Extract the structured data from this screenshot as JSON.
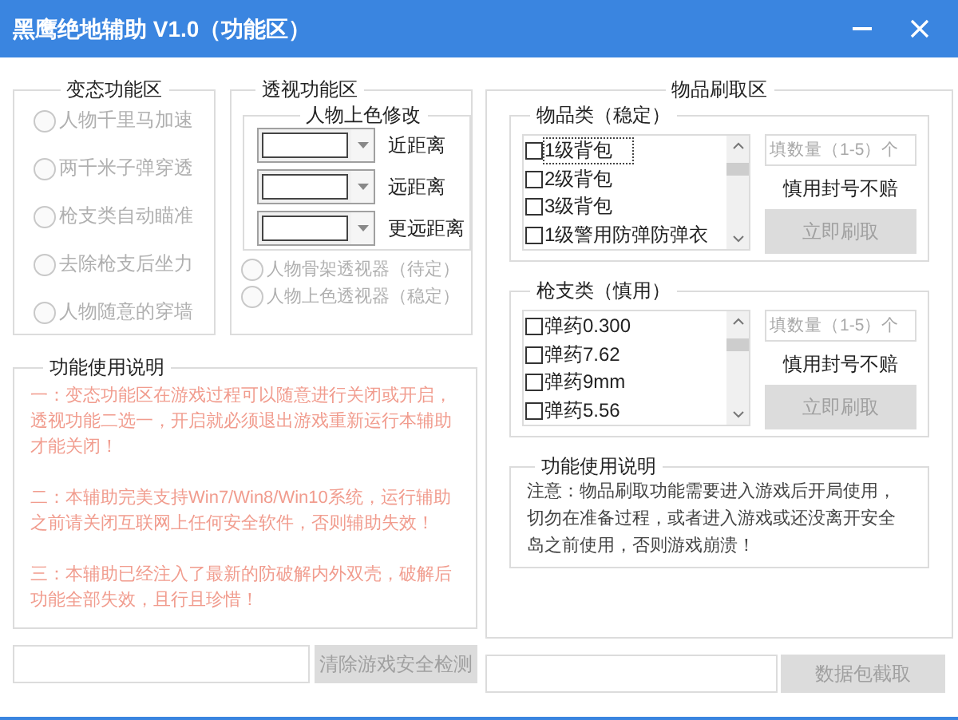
{
  "window": {
    "title": "黑鹰绝地辅助 V1.0（功能区）"
  },
  "mod_group": {
    "title": "变态功能区",
    "options": [
      {
        "label": "人物千里马加速",
        "checked": false,
        "disabled": true
      },
      {
        "label": "两千米子弹穿透",
        "checked": false,
        "disabled": true
      },
      {
        "label": "枪支类自动瞄准",
        "checked": false,
        "disabled": true
      },
      {
        "label": "去除枪支后坐力",
        "checked": false,
        "disabled": true
      },
      {
        "label": "人物随意的穿墙",
        "checked": false,
        "disabled": true
      }
    ]
  },
  "esp_group": {
    "title": "透视功能区",
    "color_group": {
      "title": "人物上色修改",
      "rows": [
        {
          "label": "近距离"
        },
        {
          "label": "远距离"
        },
        {
          "label": "更远距离"
        }
      ]
    },
    "options": [
      {
        "label": "人物骨架透视器（待定）",
        "checked": false,
        "disabled": true
      },
      {
        "label": "人物上色透视器（稳定）",
        "checked": false,
        "disabled": true
      }
    ]
  },
  "notes_left": {
    "title": "功能使用说明",
    "paragraphs": [
      "一：变态功能区在游戏过程可以随意进行关闭或开启，透视功能二选一，开启就必须退出游戏重新运行本辅助才能关闭！",
      "二：本辅助完美支持Win7/Win8/Win10系统，运行辅助之前请关闭互联网上任何安全软件，否则辅助失效！",
      "三：本辅助已经注入了最新的防破解内外双壳，破解后功能全部失效，且行且珍惜！"
    ]
  },
  "bottom_left": {
    "button": "清除游戏安全检测",
    "disabled": true
  },
  "items_area": {
    "title": "物品刷取区",
    "sections": [
      {
        "title": "物品类（稳定）",
        "items": [
          {
            "label": "1级背包",
            "checked": false,
            "focused": true
          },
          {
            "label": "2级背包",
            "checked": false,
            "focused": false
          },
          {
            "label": "3级背包",
            "checked": false,
            "focused": false
          },
          {
            "label": "1级警用防弹防弹衣",
            "checked": false,
            "focused": false
          }
        ],
        "quantity_placeholder": "填数量（1-5）个",
        "warning": "慎用封号不赔",
        "button": "立即刷取",
        "disabled": true
      },
      {
        "title": "枪支类（慎用）",
        "items": [
          {
            "label": "弹药0.300",
            "checked": false,
            "focused": false
          },
          {
            "label": "弹药7.62",
            "checked": false,
            "focused": false
          },
          {
            "label": "弹药9mm",
            "checked": false,
            "focused": false
          },
          {
            "label": "弹药5.56",
            "checked": false,
            "focused": false
          }
        ],
        "quantity_placeholder": "填数量（1-5）个",
        "warning": "慎用封号不赔",
        "button": "立即刷取",
        "disabled": true
      }
    ],
    "notes": {
      "title": "功能使用说明",
      "text": "注意：物品刷取功能需要进入游戏后开局使用，切勿在准备过程，或者进入游戏或还没离开安全岛之前使用，否则游戏崩溃！"
    }
  },
  "bottom_right": {
    "button": "数据包截取",
    "disabled": true
  }
}
